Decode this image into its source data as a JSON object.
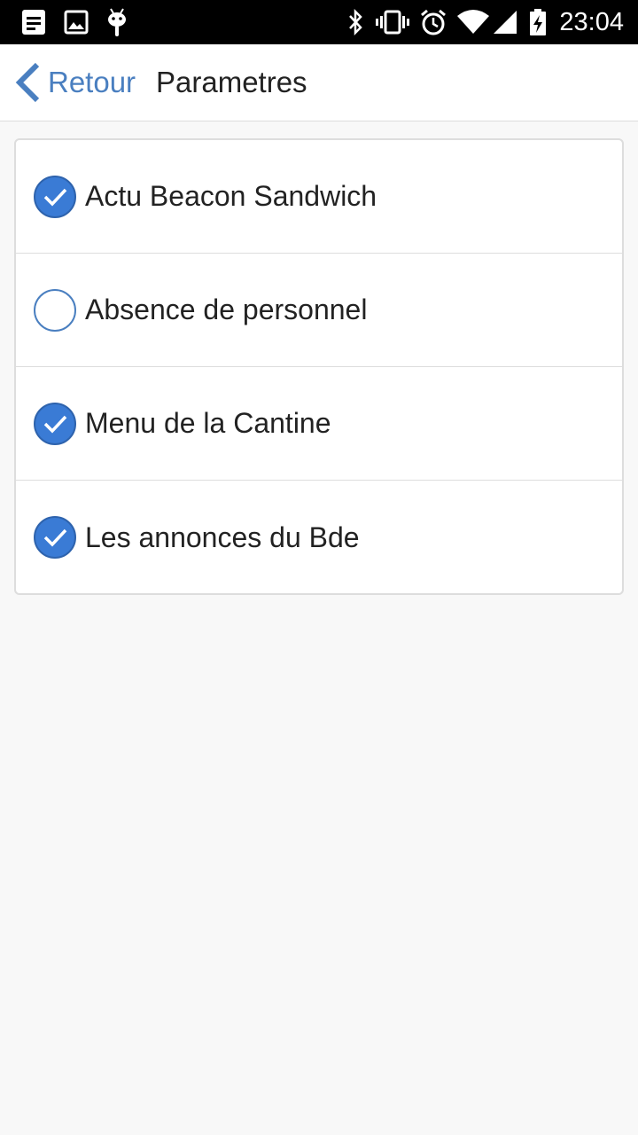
{
  "status_bar": {
    "time": "23:04",
    "left_icons": [
      "notes-icon",
      "image-icon",
      "android-icon"
    ],
    "right_icons": [
      "bluetooth-icon",
      "vibrate-icon",
      "alarm-icon",
      "wifi-icon",
      "signal-icon",
      "battery-charging-icon"
    ]
  },
  "header": {
    "back_label": "Retour",
    "title": "Parametres"
  },
  "settings": {
    "items": [
      {
        "label": "Actu Beacon Sandwich",
        "checked": true
      },
      {
        "label": "Absence de personnel",
        "checked": false
      },
      {
        "label": "Menu de la Cantine",
        "checked": true
      },
      {
        "label": "Les annonces du Bde",
        "checked": true
      }
    ]
  },
  "colors": {
    "accent": "#3a7bd5",
    "link": "#4a7fc0",
    "background": "#f8f8f8"
  }
}
